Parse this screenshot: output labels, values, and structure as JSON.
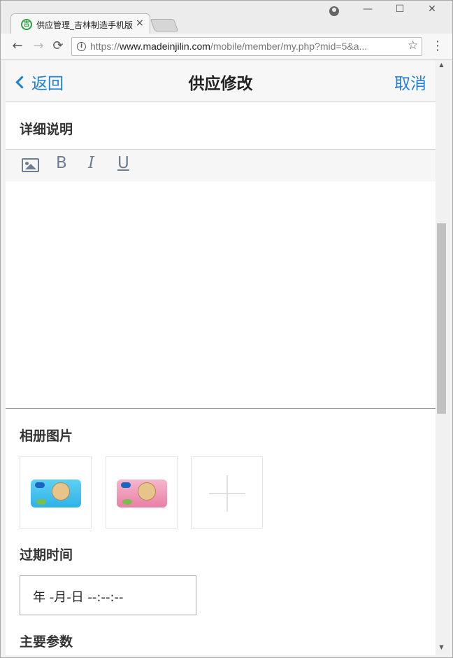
{
  "browser": {
    "tab_title": "供应管理_吉林制造手机版",
    "tab_close": "×",
    "favicon": "吉",
    "url_prefix": "https://",
    "url_host": "www.madeinjilin.com",
    "url_path": "/mobile/member/my.php?mid=5&a...",
    "back_glyph": "←",
    "forward_glyph": "→",
    "reload_glyph": "⟳",
    "star_glyph": "☆",
    "menu_glyph": "⋮",
    "minimize_glyph": "—",
    "maximize_glyph": "☐",
    "close_glyph": "✕"
  },
  "header": {
    "back_label": "返回",
    "title": "供应修改",
    "cancel_label": "取消"
  },
  "detail": {
    "label": "详细说明",
    "toolbar": {
      "bold": "B",
      "italic": "I",
      "underline": "U"
    }
  },
  "album": {
    "label": "相册图片"
  },
  "expire": {
    "label": "过期时间",
    "value": "年 -月-日 --:--:--"
  },
  "params": {
    "label": "主要参数"
  },
  "colors": {
    "accent": "#1f80d8",
    "toolbar_icon": "#6f7e8f"
  }
}
